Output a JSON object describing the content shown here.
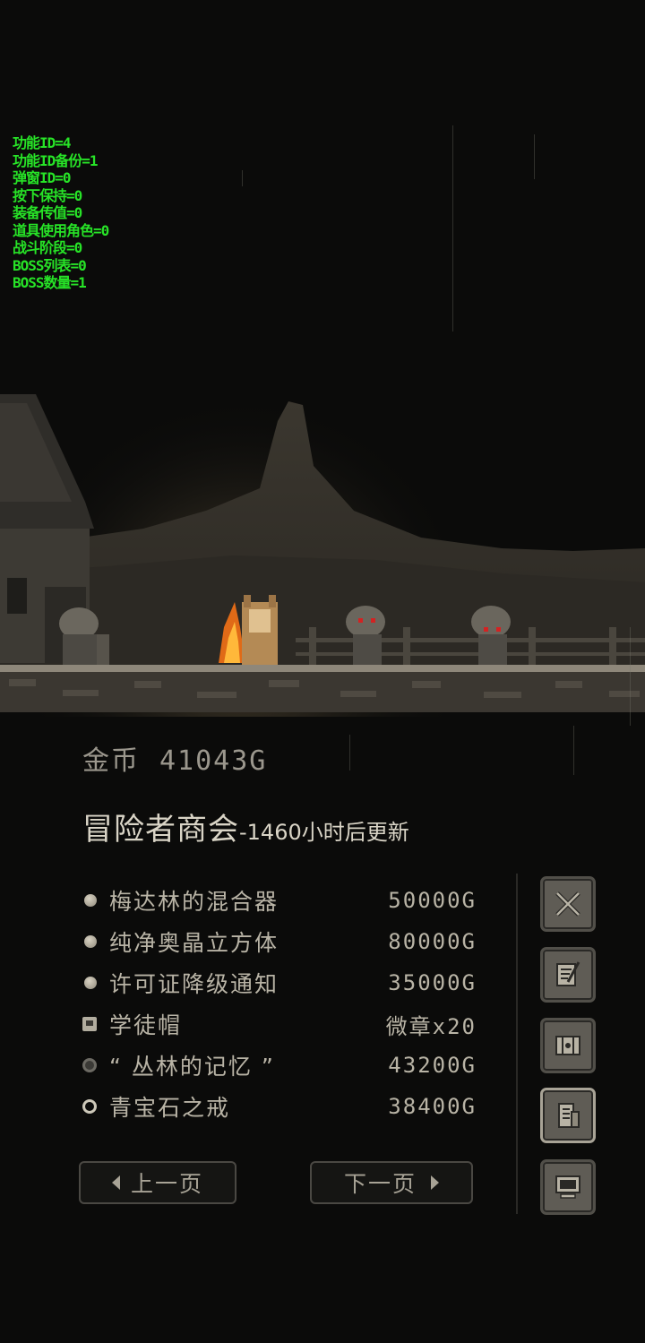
{
  "debug": {
    "lines": [
      "功能ID=4",
      "功能ID备份=1",
      "弹窗ID=0",
      "按下保持=0",
      "装备传值=0",
      "道具使用角色=0",
      "战斗阶段=0",
      "BOSS列表=0",
      "BOSS数量=1"
    ]
  },
  "gold": {
    "label": "金币",
    "value": "41043G"
  },
  "shop": {
    "title": "冒险者商会",
    "refresh": "-1460小时后更新"
  },
  "items": [
    {
      "name": "梅达林的混合器",
      "price": "50000G",
      "icon": "orb-icon"
    },
    {
      "name": "纯净奥晶立方体",
      "price": "80000G",
      "icon": "orb-icon"
    },
    {
      "name": "许可证降级通知",
      "price": "35000G",
      "icon": "orb-icon"
    },
    {
      "name": "学徒帽",
      "price": "微章x20",
      "icon": "hat-icon"
    },
    {
      "name": "“ 丛林的记忆 ”",
      "price": "43200G",
      "icon": "disc-icon"
    },
    {
      "name": "青宝石之戒",
      "price": "38400G",
      "icon": "ring-icon"
    }
  ],
  "pager": {
    "prev": "上一页",
    "next": "下一页"
  },
  "side_menu": [
    "swords-icon",
    "quill-scroll-icon",
    "map-icon",
    "shop-scroll-icon",
    "computer-icon"
  ],
  "colors": {
    "debug": "#27e327",
    "text": "#b9b4a6",
    "title": "#d9d4c6",
    "button_bg": "#5f5c55"
  }
}
